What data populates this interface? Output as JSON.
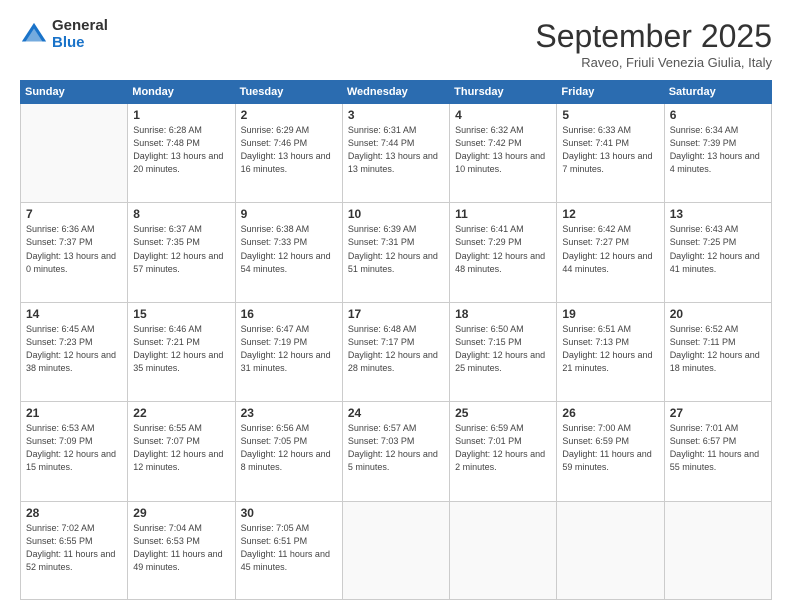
{
  "header": {
    "logo_general": "General",
    "logo_blue": "Blue",
    "month_title": "September 2025",
    "location": "Raveo, Friuli Venezia Giulia, Italy"
  },
  "weekdays": [
    "Sunday",
    "Monday",
    "Tuesday",
    "Wednesday",
    "Thursday",
    "Friday",
    "Saturday"
  ],
  "weeks": [
    [
      null,
      {
        "day": "1",
        "sunrise": "6:28 AM",
        "sunset": "7:48 PM",
        "daylight": "13 hours and 20 minutes."
      },
      {
        "day": "2",
        "sunrise": "6:29 AM",
        "sunset": "7:46 PM",
        "daylight": "13 hours and 16 minutes."
      },
      {
        "day": "3",
        "sunrise": "6:31 AM",
        "sunset": "7:44 PM",
        "daylight": "13 hours and 13 minutes."
      },
      {
        "day": "4",
        "sunrise": "6:32 AM",
        "sunset": "7:42 PM",
        "daylight": "13 hours and 10 minutes."
      },
      {
        "day": "5",
        "sunrise": "6:33 AM",
        "sunset": "7:41 PM",
        "daylight": "13 hours and 7 minutes."
      },
      {
        "day": "6",
        "sunrise": "6:34 AM",
        "sunset": "7:39 PM",
        "daylight": "13 hours and 4 minutes."
      }
    ],
    [
      {
        "day": "7",
        "sunrise": "6:36 AM",
        "sunset": "7:37 PM",
        "daylight": "13 hours and 0 minutes."
      },
      {
        "day": "8",
        "sunrise": "6:37 AM",
        "sunset": "7:35 PM",
        "daylight": "12 hours and 57 minutes."
      },
      {
        "day": "9",
        "sunrise": "6:38 AM",
        "sunset": "7:33 PM",
        "daylight": "12 hours and 54 minutes."
      },
      {
        "day": "10",
        "sunrise": "6:39 AM",
        "sunset": "7:31 PM",
        "daylight": "12 hours and 51 minutes."
      },
      {
        "day": "11",
        "sunrise": "6:41 AM",
        "sunset": "7:29 PM",
        "daylight": "12 hours and 48 minutes."
      },
      {
        "day": "12",
        "sunrise": "6:42 AM",
        "sunset": "7:27 PM",
        "daylight": "12 hours and 44 minutes."
      },
      {
        "day": "13",
        "sunrise": "6:43 AM",
        "sunset": "7:25 PM",
        "daylight": "12 hours and 41 minutes."
      }
    ],
    [
      {
        "day": "14",
        "sunrise": "6:45 AM",
        "sunset": "7:23 PM",
        "daylight": "12 hours and 38 minutes."
      },
      {
        "day": "15",
        "sunrise": "6:46 AM",
        "sunset": "7:21 PM",
        "daylight": "12 hours and 35 minutes."
      },
      {
        "day": "16",
        "sunrise": "6:47 AM",
        "sunset": "7:19 PM",
        "daylight": "12 hours and 31 minutes."
      },
      {
        "day": "17",
        "sunrise": "6:48 AM",
        "sunset": "7:17 PM",
        "daylight": "12 hours and 28 minutes."
      },
      {
        "day": "18",
        "sunrise": "6:50 AM",
        "sunset": "7:15 PM",
        "daylight": "12 hours and 25 minutes."
      },
      {
        "day": "19",
        "sunrise": "6:51 AM",
        "sunset": "7:13 PM",
        "daylight": "12 hours and 21 minutes."
      },
      {
        "day": "20",
        "sunrise": "6:52 AM",
        "sunset": "7:11 PM",
        "daylight": "12 hours and 18 minutes."
      }
    ],
    [
      {
        "day": "21",
        "sunrise": "6:53 AM",
        "sunset": "7:09 PM",
        "daylight": "12 hours and 15 minutes."
      },
      {
        "day": "22",
        "sunrise": "6:55 AM",
        "sunset": "7:07 PM",
        "daylight": "12 hours and 12 minutes."
      },
      {
        "day": "23",
        "sunrise": "6:56 AM",
        "sunset": "7:05 PM",
        "daylight": "12 hours and 8 minutes."
      },
      {
        "day": "24",
        "sunrise": "6:57 AM",
        "sunset": "7:03 PM",
        "daylight": "12 hours and 5 minutes."
      },
      {
        "day": "25",
        "sunrise": "6:59 AM",
        "sunset": "7:01 PM",
        "daylight": "12 hours and 2 minutes."
      },
      {
        "day": "26",
        "sunrise": "7:00 AM",
        "sunset": "6:59 PM",
        "daylight": "11 hours and 59 minutes."
      },
      {
        "day": "27",
        "sunrise": "7:01 AM",
        "sunset": "6:57 PM",
        "daylight": "11 hours and 55 minutes."
      }
    ],
    [
      {
        "day": "28",
        "sunrise": "7:02 AM",
        "sunset": "6:55 PM",
        "daylight": "11 hours and 52 minutes."
      },
      {
        "day": "29",
        "sunrise": "7:04 AM",
        "sunset": "6:53 PM",
        "daylight": "11 hours and 49 minutes."
      },
      {
        "day": "30",
        "sunrise": "7:05 AM",
        "sunset": "6:51 PM",
        "daylight": "11 hours and 45 minutes."
      },
      null,
      null,
      null,
      null
    ]
  ]
}
